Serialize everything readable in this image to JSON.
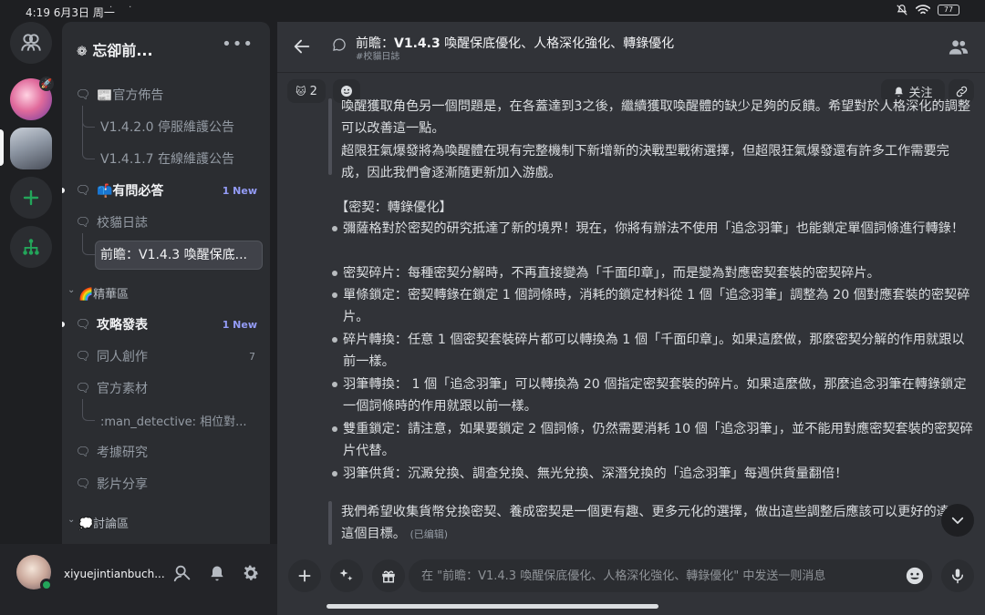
{
  "status_bar": {
    "time": "4:19 6月3日 周一",
    "battery": "77"
  },
  "server_rail": {
    "items": [
      "direct-messages",
      "server-sd",
      "server-current",
      "add-server",
      "discover"
    ]
  },
  "channel_panel": {
    "guild_name": "忘卻前...",
    "more": "•••",
    "items": [
      {
        "type": "channel",
        "label": "📰官方佈告",
        "icon": "forum-icon"
      },
      {
        "type": "thread",
        "label": "V1.4.2.0 停服維護公告"
      },
      {
        "type": "thread",
        "label": "V1.4.1.7 在線維護公告"
      },
      {
        "type": "channel",
        "label": "📫有問必答",
        "icon": "forum-icon",
        "badge": "1 New",
        "unread": true
      },
      {
        "type": "channel",
        "label": "校貓日誌",
        "icon": "forum-icon"
      },
      {
        "type": "thread",
        "label": "前瞻：V1.4.3 喚醒保底...",
        "active": true
      },
      {
        "type": "category",
        "label": "🌈精華區"
      },
      {
        "type": "channel",
        "label": "攻略發表",
        "icon": "forum-icon",
        "badge": "1 New",
        "unread": true
      },
      {
        "type": "channel",
        "label": "同人創作",
        "icon": "forum-icon",
        "count": "7"
      },
      {
        "type": "channel",
        "label": "官方素材",
        "icon": "forum-icon"
      },
      {
        "type": "thread",
        "label": ":man_detective: 相位對..."
      },
      {
        "type": "channel",
        "label": "考據研究",
        "icon": "forum-icon"
      },
      {
        "type": "channel",
        "label": "影片分享",
        "icon": "forum-icon"
      },
      {
        "type": "category",
        "label": "💭討論區"
      }
    ]
  },
  "user_bar": {
    "username": "xiyuejintianbuch..."
  },
  "header": {
    "title_prefix": "前瞻：",
    "title_bold": "V1.4.3",
    "title_rest": " 喚醒保底優化、人格深化強化、轉錄優化",
    "subtitle": "#校貓日誌"
  },
  "toolbar": {
    "reaction_count": "2",
    "follow_label": "关注"
  },
  "message": {
    "p1": "喚醒獲取角色另一個問題是，在各蓋達到3之後，繼續獲取喚醒體的缺少足夠的反饋。希望對於人格深化的調整可以改善這一點。",
    "p2": "超限狂氣爆發將為喚醒體在現有完整機制下新增新的決戰型戰術選擇，但超限狂氣爆發還有許多工作需要完成，因此我們會逐漸隨更新加入游戲。",
    "section_title": "【密契：轉錄優化】",
    "bullets": [
      "彌薩格對於密契的研究抵達了新的境界！現在，你將有辦法不使用「追念羽筆」也能鎖定單個詞條進行轉錄！",
      "密契碎片：每種密契分解時，不再直接變為「千面印章」，而是變為對應密契套裝的密契碎片。",
      "單條鎖定：密契轉錄在鎖定 1 個詞條時，消耗的鎖定材料從 1 個「追念羽筆」調整為 20 個對應套裝的密契碎片。",
      "碎片轉換：任意 1 個密契套裝碎片都可以轉換為 1 個「千面印章」。如果這麼做，那麼密契分解的作用就跟以前一樣。",
      "羽筆轉換： 1 個「追念羽筆」可以轉換為 20 個指定密契套裝的碎片。如果這麼做，那麼追念羽筆在轉錄鎖定一個詞條時的作用就跟以前一樣。",
      "雙重鎖定：請注意，如果要鎖定 2 個詞條，仍然需要消耗 10 個「追念羽筆」，並不能用對應密契套裝的密契碎片代替。",
      "羽筆供貨：沉澱兌換、調查兌換、無光兌換、深潛兌換的「追念羽筆」每週供貨量翻倍！"
    ],
    "closing": "我們希望收集貨幣兌換密契、養成密契是一個更有趣、更多元化的選擇，做出這些調整后應該可以更好的達成這個目標。",
    "edited": "(已编辑)"
  },
  "composer": {
    "placeholder": "在 \"前瞻：V1.4.3 喚醒保底優化、人格深化強化、轉錄優化\" 中发送一则消息"
  },
  "colors": {
    "accent": "#949cf7",
    "online": "#23a55a",
    "bg_main": "#313338",
    "bg_panel": "#2b2d31"
  }
}
